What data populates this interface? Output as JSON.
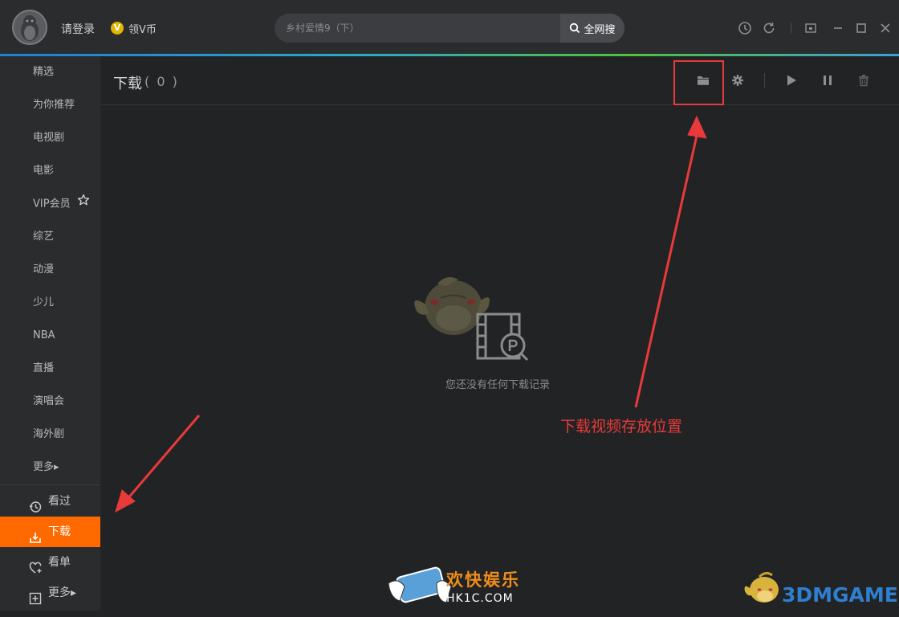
{
  "header": {
    "login_label": "请登录",
    "vcoin_badge": "V",
    "vcoin_label": "领V币",
    "search_placeholder": "乡村爱情9（下）",
    "search_button": "全网搜",
    "icons": [
      "history-icon",
      "refresh-icon",
      "mini-mode-icon",
      "minimize-icon",
      "maximize-icon",
      "close-icon"
    ]
  },
  "sidebar": {
    "items": [
      {
        "label": "精选"
      },
      {
        "label": "为你推荐"
      },
      {
        "label": "电视剧"
      },
      {
        "label": "电影"
      },
      {
        "label": "VIP会员"
      },
      {
        "label": "综艺"
      },
      {
        "label": "动漫"
      },
      {
        "label": "少儿"
      },
      {
        "label": "NBA"
      },
      {
        "label": "直播"
      },
      {
        "label": "演唱会"
      },
      {
        "label": "海外剧"
      },
      {
        "label": "更多▸"
      }
    ],
    "bottom": [
      {
        "label": "看过",
        "icon": "history-icon"
      },
      {
        "label": "下载",
        "icon": "download-icon",
        "active": true
      },
      {
        "label": "看单",
        "icon": "heart-plus-icon"
      },
      {
        "label": "更多▸",
        "icon": "plus-box-icon"
      }
    ]
  },
  "main": {
    "title": "下载",
    "count": "( 0 )",
    "toolbar_icons": [
      "folder-icon",
      "settings-icon",
      "play-icon",
      "pause-icon",
      "trash-icon"
    ],
    "empty_message": "您还没有任何下载记录"
  },
  "annotation": {
    "label": "下载视频存放位置",
    "color": "#e83a3a"
  },
  "watermarks": {
    "left_title": "欢快娱乐",
    "left_sub": "HK1C.COM",
    "right_text": "3DMGAME"
  },
  "colors": {
    "accent_active": "#ff6a00",
    "vcoin": "#e4b400",
    "annotation_red": "#e83a3a"
  }
}
